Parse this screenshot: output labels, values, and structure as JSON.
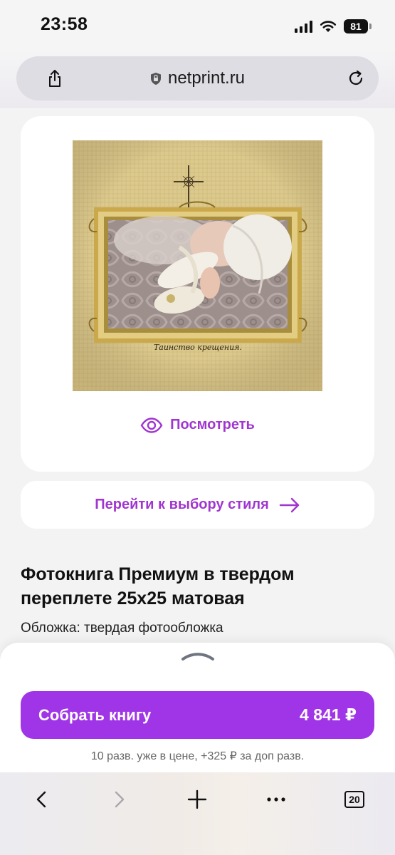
{
  "status_bar": {
    "time": "23:58",
    "battery": "81",
    "icons": [
      "signal-icon",
      "wifi-icon",
      "battery-icon"
    ]
  },
  "address_bar": {
    "url": "netprint.ru",
    "icons": [
      "share-icon",
      "lock-shield-icon",
      "reload-icon"
    ]
  },
  "cover": {
    "caption": "Таинство крещения.",
    "preview_label": "Посмотреть",
    "icons": [
      "cross-icon",
      "eye-icon"
    ]
  },
  "style_button": {
    "label": "Перейти к выбору стиля",
    "icon": "arrow-right-icon"
  },
  "product": {
    "title": "Фотокнига Премиум в твердом переплете 25x25 матовая",
    "cover_type": "Обложка: твердая фотообложка"
  },
  "bottom_sheet": {
    "build_label": "Собрать книгу",
    "price": "4 841 ₽",
    "note": "10 разв. уже в цене, +325 ₽ за доп разв.",
    "icon": "chevron-up-icon"
  },
  "toolbar": {
    "tabs_count": "20",
    "icons": [
      "back-icon",
      "forward-icon",
      "new-tab-icon",
      "more-icon",
      "tabs-icon"
    ]
  },
  "colors": {
    "accent": "#a035d0",
    "button": "#a035e7",
    "card": "#ffffff",
    "background": "#f4f3f4"
  }
}
